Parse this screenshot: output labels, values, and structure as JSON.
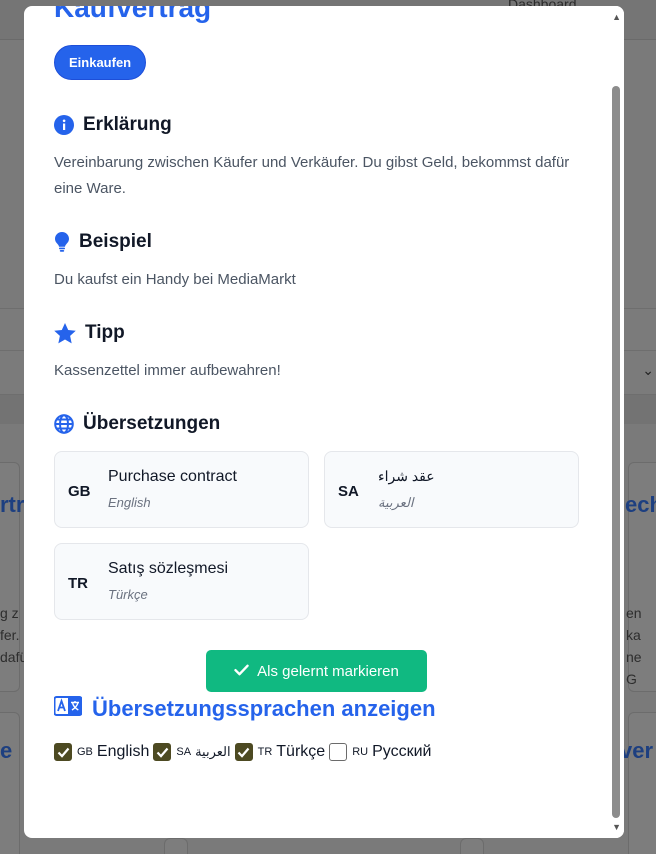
{
  "background": {
    "dashboard_link": "Dashboard",
    "left_fragments": [
      "rtra"
    ],
    "right_fragments": [
      "ech"
    ],
    "left_text": [
      "g z",
      "fer.",
      "dafü"
    ],
    "right_text": [
      "en ka",
      "ne G"
    ],
    "bottom_left": "e",
    "bottom_right": "ver"
  },
  "modal": {
    "title": "Kaufvertrag",
    "category_label": "Einkaufen",
    "sections": [
      {
        "heading": "Erklärung",
        "icon": "info-icon",
        "text": "Vereinbarung zwischen Käufer und Verkäufer. Du gibst Geld, bekommst dafür eine Ware."
      },
      {
        "heading": "Beispiel",
        "icon": "lightbulb-icon",
        "text": "Du kaufst ein Handy bei MediaMarkt"
      },
      {
        "heading": "Tipp",
        "icon": "star-icon",
        "text": "Kassenzettel immer aufbewahren!"
      }
    ],
    "translations_heading": "Übersetzungen",
    "translations": [
      {
        "code": "GB",
        "word": "Purchase contract",
        "language": "English"
      },
      {
        "code": "SA",
        "word": "عقد شراء",
        "language": "العربية"
      },
      {
        "code": "TR",
        "word": "Satış sözleşmesi",
        "language": "Türkçe"
      }
    ],
    "learned_button": "Als gelernt markieren",
    "languages_heading": "Übersetzungssprachen anzeigen",
    "language_options": [
      {
        "code": "GB",
        "label": "English",
        "checked": true
      },
      {
        "code": "SA",
        "label": "العربية",
        "checked": true
      },
      {
        "code": "TR",
        "label": "Türkçe",
        "checked": true
      },
      {
        "code": "RU",
        "label": "Русский",
        "checked": false
      }
    ]
  },
  "colors": {
    "accent": "#2563eb",
    "success": "#10b981",
    "heading": "#111827",
    "muted": "#6b7280"
  }
}
